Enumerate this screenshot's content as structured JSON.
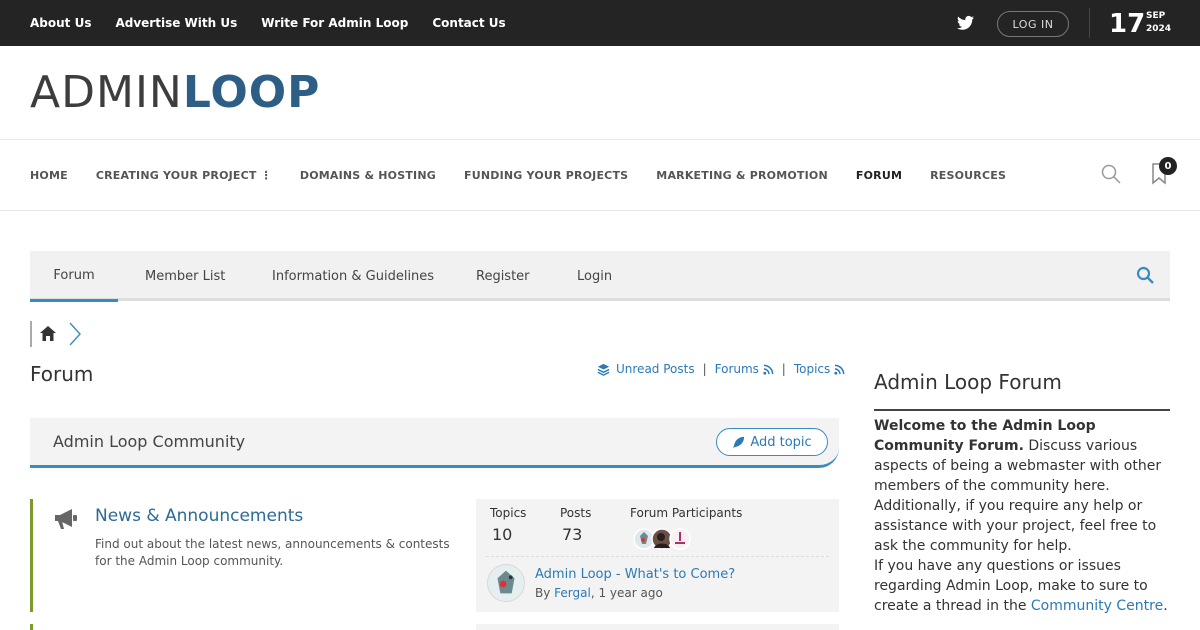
{
  "topbar": {
    "links": [
      "About Us",
      "Advertise With Us",
      "Write For Admin Loop",
      "Contact Us"
    ],
    "login_label": "LOG IN",
    "date_day": "17",
    "date_month": "SEP",
    "date_year": "2024"
  },
  "logo": {
    "part1": "ADMIN",
    "part2": "LOOP"
  },
  "mainnav": {
    "items": [
      "HOME",
      "CREATING YOUR PROJECT ⋮",
      "DOMAINS & HOSTING",
      "FUNDING YOUR PROJECTS",
      "MARKETING & PROMOTION",
      "FORUM",
      "RESOURCES"
    ],
    "bookmark_count": "0"
  },
  "forumnav": {
    "tabs": [
      "Forum",
      "Member List",
      "Information & Guidelines",
      "Register",
      "Login"
    ]
  },
  "page": {
    "title": "Forum",
    "quicklinks": {
      "unread": "Unread Posts",
      "forums": "Forums",
      "topics": "Topics",
      "sep": "|"
    }
  },
  "community": {
    "title": "Admin Loop Community",
    "add_topic": "Add topic"
  },
  "forum_row": {
    "name": "News & Announcements",
    "description": "Find out about the latest news, announcements & contests for the Admin Loop community.",
    "stats": {
      "topics_label": "Topics",
      "topics": "10",
      "posts_label": "Posts",
      "posts": "73",
      "participants_label": "Forum Participants"
    },
    "last_post": {
      "title": "Admin Loop - What's to Come?",
      "by_prefix": "By",
      "author": "Fergal",
      "when": ", 1 year ago"
    }
  },
  "sidebar": {
    "title": "Admin Loop Forum",
    "intro_bold": "Welcome to the Admin Loop Community Forum.",
    "intro_rest": " Discuss various aspects of being a webmaster with other members of the community here. Additionally, if you require any help or assistance with your project, feel free to ask the community for help.",
    "p2_text": "If you have any questions or issues regarding Admin Loop, make to sure to create a thread in the ",
    "p2_link": "Community Centre",
    "p2_end": "."
  },
  "colors": {
    "accent": "#3a8ac3",
    "link": "#2b7ab5",
    "topbar": "#242424",
    "forum_border": "#7a9a2d"
  }
}
